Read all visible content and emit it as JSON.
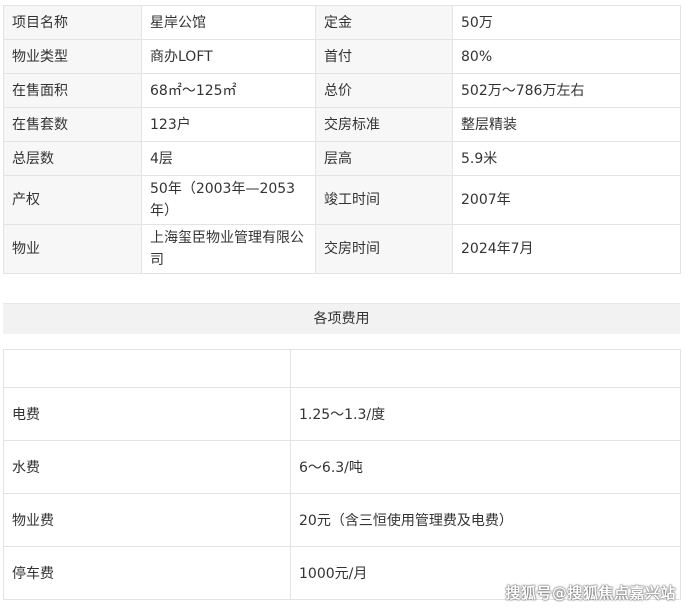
{
  "info_table": {
    "rows": [
      {
        "k1": "项目名称",
        "v1": "星岸公馆",
        "k2": "定金",
        "v2": "50万"
      },
      {
        "k1": "物业类型",
        "v1": "商办LOFT",
        "k2": "首付",
        "v2": "80%"
      },
      {
        "k1": "在售面积",
        "v1": "68㎡～125㎡",
        "k2": "总价",
        "v2": "502万～786万左右"
      },
      {
        "k1": "在售套数",
        "v1": "123户",
        "k2": "交房标准",
        "v2": "整层精装"
      },
      {
        "k1": "总层数",
        "v1": "4层",
        "k2": "层高",
        "v2": "5.9米"
      },
      {
        "k1": "产权",
        "v1": "50年（2003年—2053年）",
        "k2": "竣工时间",
        "v2": "2007年"
      },
      {
        "k1": "物业",
        "v1": "上海玺臣物业管理有限公司",
        "k2": "交房时间",
        "v2": "2024年7月"
      }
    ]
  },
  "fees_section": {
    "title": "各项费用"
  },
  "fee_table": {
    "header": {
      "c1": "",
      "c2": ""
    },
    "rows": [
      {
        "name": "电费",
        "value": "1.25～1.3/度"
      },
      {
        "name": "水费",
        "value": "6～6.3/吨"
      },
      {
        "name": "物业费",
        "value": "20元（含三恒使用管理费及电费）"
      },
      {
        "name": "停车费",
        "value": "1000元/月"
      }
    ]
  },
  "watermark": {
    "text": "搜狐号@搜狐焦点嘉兴站"
  }
}
